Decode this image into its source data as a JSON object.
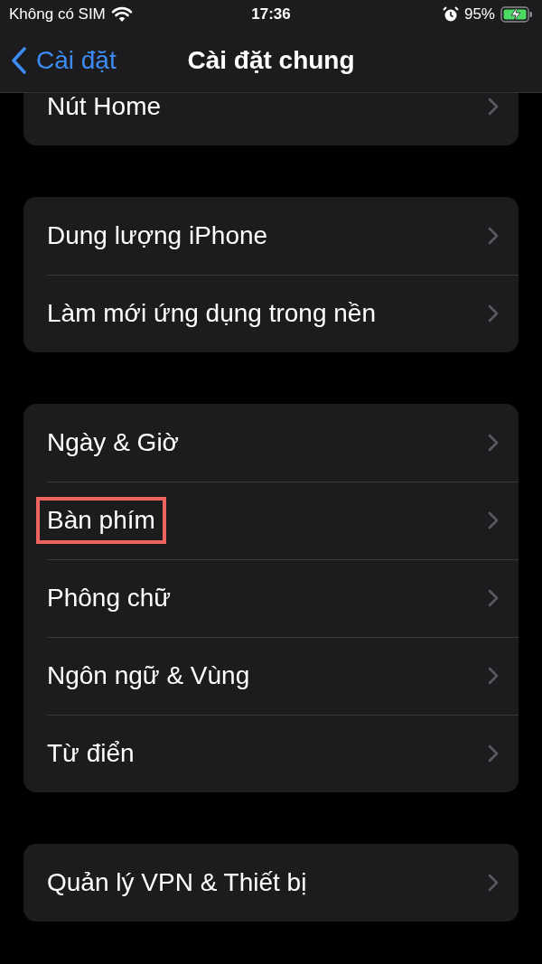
{
  "status_bar": {
    "carrier": "Không có SIM",
    "time": "17:36",
    "battery": "95%"
  },
  "nav": {
    "back": "Cài đặt",
    "title": "Cài đặt chung"
  },
  "groups": [
    {
      "clipped": true,
      "items": [
        {
          "label": "Nút Home",
          "highlighted": false
        }
      ]
    },
    {
      "clipped": false,
      "items": [
        {
          "label": "Dung lượng iPhone",
          "highlighted": false
        },
        {
          "label": "Làm mới ứng dụng trong nền",
          "highlighted": false
        }
      ]
    },
    {
      "clipped": false,
      "items": [
        {
          "label": "Ngày & Giờ",
          "highlighted": false
        },
        {
          "label": "Bàn phím",
          "highlighted": true
        },
        {
          "label": "Phông chữ",
          "highlighted": false
        },
        {
          "label": "Ngôn ngữ & Vùng",
          "highlighted": false
        },
        {
          "label": "Từ điển",
          "highlighted": false
        }
      ]
    },
    {
      "clipped": false,
      "items": [
        {
          "label": "Quản lý VPN & Thiết bị",
          "highlighted": false
        }
      ]
    }
  ]
}
